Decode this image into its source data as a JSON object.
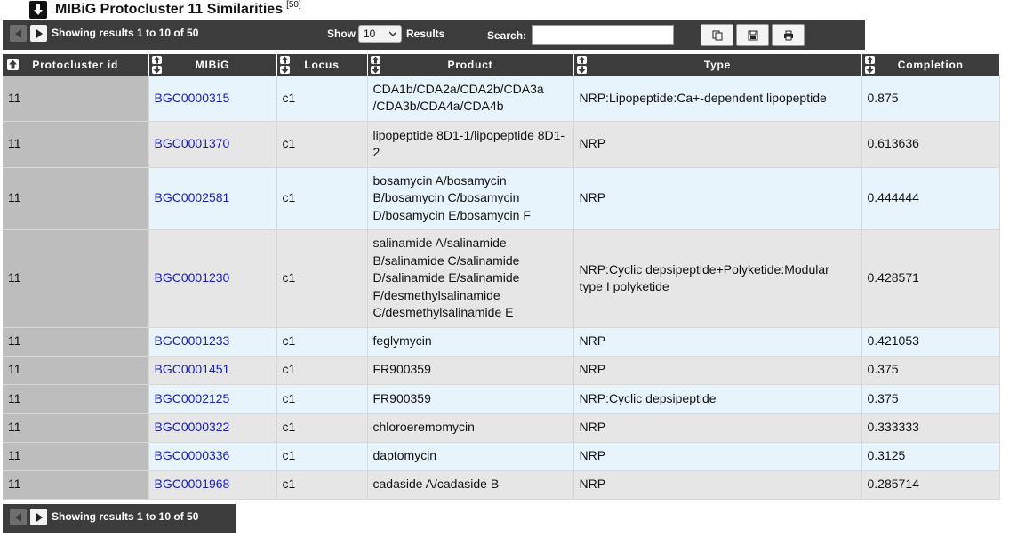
{
  "title": {
    "text": "MIBiG Protocluster 11 Similarities",
    "count": "[50]"
  },
  "toolbar": {
    "showing": "Showing results 1 to 10 of 50",
    "show_label": "Show",
    "length_value": "10",
    "results_label": "Results",
    "search_label": "Search:",
    "search_value": "",
    "buttons": {
      "copy": "copy-icon",
      "save": "save-icon",
      "print": "print-icon"
    }
  },
  "table": {
    "columns": [
      "Protocluster id",
      "MIBiG",
      "Locus",
      "Product",
      "Type",
      "Completion"
    ],
    "rows": [
      {
        "pid": "11",
        "mibig": "BGC0000315",
        "locus": "c1",
        "product": "CDA1b/CDA2a/CDA2b/CDA3a /CDA3b/CDA4a/CDA4b",
        "type": "NRP:Lipopeptide:Ca+-dependent lipopeptide",
        "completion": "0.875"
      },
      {
        "pid": "11",
        "mibig": "BGC0001370",
        "locus": "c1",
        "product": "lipopeptide 8D1-1/lipopeptide 8D1-2",
        "type": "NRP",
        "completion": "0.613636"
      },
      {
        "pid": "11",
        "mibig": "BGC0002581",
        "locus": "c1",
        "product": "bosamycin A/bosamycin B/bosamycin C/bosamycin D/bosamycin E/bosamycin F",
        "type": "NRP",
        "completion": "0.444444"
      },
      {
        "pid": "11",
        "mibig": "BGC0001230",
        "locus": "c1",
        "product": "salinamide A/salinamide B/salinamide C/salinamide D/salinamide E/salinamide F/desmethylsalinamide C/desmethylsalinamide E",
        "type": "NRP:Cyclic depsipeptide+Polyketide:Modular type I polyketide",
        "completion": "0.428571"
      },
      {
        "pid": "11",
        "mibig": "BGC0001233",
        "locus": "c1",
        "product": "feglymycin",
        "type": "NRP",
        "completion": "0.421053"
      },
      {
        "pid": "11",
        "mibig": "BGC0001451",
        "locus": "c1",
        "product": "FR900359",
        "type": "NRP",
        "completion": "0.375"
      },
      {
        "pid": "11",
        "mibig": "BGC0002125",
        "locus": "c1",
        "product": "FR900359",
        "type": "NRP:Cyclic depsipeptide",
        "completion": "0.375"
      },
      {
        "pid": "11",
        "mibig": "BGC0000322",
        "locus": "c1",
        "product": "chloroeremomycin",
        "type": "NRP",
        "completion": "0.333333"
      },
      {
        "pid": "11",
        "mibig": "BGC0000336",
        "locus": "c1",
        "product": "daptomycin",
        "type": "NRP",
        "completion": "0.3125"
      },
      {
        "pid": "11",
        "mibig": "BGC0001968",
        "locus": "c1",
        "product": "cadaside A/cadaside B",
        "type": "NRP",
        "completion": "0.285714"
      }
    ]
  },
  "footer": {
    "showing": "Showing results 1 to 10 of 50"
  },
  "colors": {
    "toolbar_bg": "#3c3c3c",
    "row_odd": "#e8f4fc",
    "row_even": "#e6e6e6",
    "id_cell": "#bdbdbd",
    "link": "#1a20b8"
  }
}
